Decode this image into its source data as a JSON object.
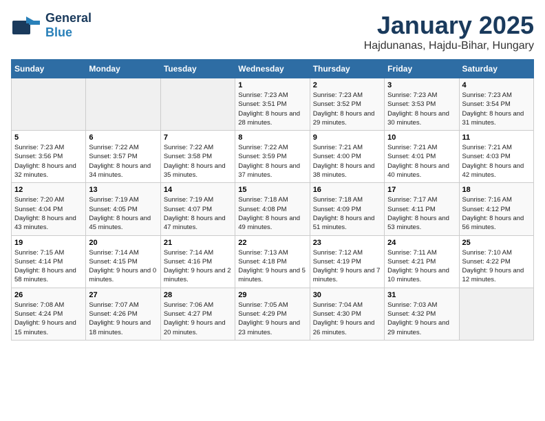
{
  "header": {
    "logo_general": "General",
    "logo_blue": "Blue",
    "title": "January 2025",
    "subtitle": "Hajdunanas, Hajdu-Bihar, Hungary"
  },
  "days_of_week": [
    "Sunday",
    "Monday",
    "Tuesday",
    "Wednesday",
    "Thursday",
    "Friday",
    "Saturday"
  ],
  "weeks": [
    [
      {
        "day": "",
        "sunrise": "",
        "sunset": "",
        "daylight": ""
      },
      {
        "day": "",
        "sunrise": "",
        "sunset": "",
        "daylight": ""
      },
      {
        "day": "",
        "sunrise": "",
        "sunset": "",
        "daylight": ""
      },
      {
        "day": "1",
        "sunrise": "Sunrise: 7:23 AM",
        "sunset": "Sunset: 3:51 PM",
        "daylight": "Daylight: 8 hours and 28 minutes."
      },
      {
        "day": "2",
        "sunrise": "Sunrise: 7:23 AM",
        "sunset": "Sunset: 3:52 PM",
        "daylight": "Daylight: 8 hours and 29 minutes."
      },
      {
        "day": "3",
        "sunrise": "Sunrise: 7:23 AM",
        "sunset": "Sunset: 3:53 PM",
        "daylight": "Daylight: 8 hours and 30 minutes."
      },
      {
        "day": "4",
        "sunrise": "Sunrise: 7:23 AM",
        "sunset": "Sunset: 3:54 PM",
        "daylight": "Daylight: 8 hours and 31 minutes."
      }
    ],
    [
      {
        "day": "5",
        "sunrise": "Sunrise: 7:23 AM",
        "sunset": "Sunset: 3:56 PM",
        "daylight": "Daylight: 8 hours and 32 minutes."
      },
      {
        "day": "6",
        "sunrise": "Sunrise: 7:22 AM",
        "sunset": "Sunset: 3:57 PM",
        "daylight": "Daylight: 8 hours and 34 minutes."
      },
      {
        "day": "7",
        "sunrise": "Sunrise: 7:22 AM",
        "sunset": "Sunset: 3:58 PM",
        "daylight": "Daylight: 8 hours and 35 minutes."
      },
      {
        "day": "8",
        "sunrise": "Sunrise: 7:22 AM",
        "sunset": "Sunset: 3:59 PM",
        "daylight": "Daylight: 8 hours and 37 minutes."
      },
      {
        "day": "9",
        "sunrise": "Sunrise: 7:21 AM",
        "sunset": "Sunset: 4:00 PM",
        "daylight": "Daylight: 8 hours and 38 minutes."
      },
      {
        "day": "10",
        "sunrise": "Sunrise: 7:21 AM",
        "sunset": "Sunset: 4:01 PM",
        "daylight": "Daylight: 8 hours and 40 minutes."
      },
      {
        "day": "11",
        "sunrise": "Sunrise: 7:21 AM",
        "sunset": "Sunset: 4:03 PM",
        "daylight": "Daylight: 8 hours and 42 minutes."
      }
    ],
    [
      {
        "day": "12",
        "sunrise": "Sunrise: 7:20 AM",
        "sunset": "Sunset: 4:04 PM",
        "daylight": "Daylight: 8 hours and 43 minutes."
      },
      {
        "day": "13",
        "sunrise": "Sunrise: 7:19 AM",
        "sunset": "Sunset: 4:05 PM",
        "daylight": "Daylight: 8 hours and 45 minutes."
      },
      {
        "day": "14",
        "sunrise": "Sunrise: 7:19 AM",
        "sunset": "Sunset: 4:07 PM",
        "daylight": "Daylight: 8 hours and 47 minutes."
      },
      {
        "day": "15",
        "sunrise": "Sunrise: 7:18 AM",
        "sunset": "Sunset: 4:08 PM",
        "daylight": "Daylight: 8 hours and 49 minutes."
      },
      {
        "day": "16",
        "sunrise": "Sunrise: 7:18 AM",
        "sunset": "Sunset: 4:09 PM",
        "daylight": "Daylight: 8 hours and 51 minutes."
      },
      {
        "day": "17",
        "sunrise": "Sunrise: 7:17 AM",
        "sunset": "Sunset: 4:11 PM",
        "daylight": "Daylight: 8 hours and 53 minutes."
      },
      {
        "day": "18",
        "sunrise": "Sunrise: 7:16 AM",
        "sunset": "Sunset: 4:12 PM",
        "daylight": "Daylight: 8 hours and 56 minutes."
      }
    ],
    [
      {
        "day": "19",
        "sunrise": "Sunrise: 7:15 AM",
        "sunset": "Sunset: 4:14 PM",
        "daylight": "Daylight: 8 hours and 58 minutes."
      },
      {
        "day": "20",
        "sunrise": "Sunrise: 7:14 AM",
        "sunset": "Sunset: 4:15 PM",
        "daylight": "Daylight: 9 hours and 0 minutes."
      },
      {
        "day": "21",
        "sunrise": "Sunrise: 7:14 AM",
        "sunset": "Sunset: 4:16 PM",
        "daylight": "Daylight: 9 hours and 2 minutes."
      },
      {
        "day": "22",
        "sunrise": "Sunrise: 7:13 AM",
        "sunset": "Sunset: 4:18 PM",
        "daylight": "Daylight: 9 hours and 5 minutes."
      },
      {
        "day": "23",
        "sunrise": "Sunrise: 7:12 AM",
        "sunset": "Sunset: 4:19 PM",
        "daylight": "Daylight: 9 hours and 7 minutes."
      },
      {
        "day": "24",
        "sunrise": "Sunrise: 7:11 AM",
        "sunset": "Sunset: 4:21 PM",
        "daylight": "Daylight: 9 hours and 10 minutes."
      },
      {
        "day": "25",
        "sunrise": "Sunrise: 7:10 AM",
        "sunset": "Sunset: 4:22 PM",
        "daylight": "Daylight: 9 hours and 12 minutes."
      }
    ],
    [
      {
        "day": "26",
        "sunrise": "Sunrise: 7:08 AM",
        "sunset": "Sunset: 4:24 PM",
        "daylight": "Daylight: 9 hours and 15 minutes."
      },
      {
        "day": "27",
        "sunrise": "Sunrise: 7:07 AM",
        "sunset": "Sunset: 4:26 PM",
        "daylight": "Daylight: 9 hours and 18 minutes."
      },
      {
        "day": "28",
        "sunrise": "Sunrise: 7:06 AM",
        "sunset": "Sunset: 4:27 PM",
        "daylight": "Daylight: 9 hours and 20 minutes."
      },
      {
        "day": "29",
        "sunrise": "Sunrise: 7:05 AM",
        "sunset": "Sunset: 4:29 PM",
        "daylight": "Daylight: 9 hours and 23 minutes."
      },
      {
        "day": "30",
        "sunrise": "Sunrise: 7:04 AM",
        "sunset": "Sunset: 4:30 PM",
        "daylight": "Daylight: 9 hours and 26 minutes."
      },
      {
        "day": "31",
        "sunrise": "Sunrise: 7:03 AM",
        "sunset": "Sunset: 4:32 PM",
        "daylight": "Daylight: 9 hours and 29 minutes."
      },
      {
        "day": "",
        "sunrise": "",
        "sunset": "",
        "daylight": ""
      }
    ]
  ]
}
